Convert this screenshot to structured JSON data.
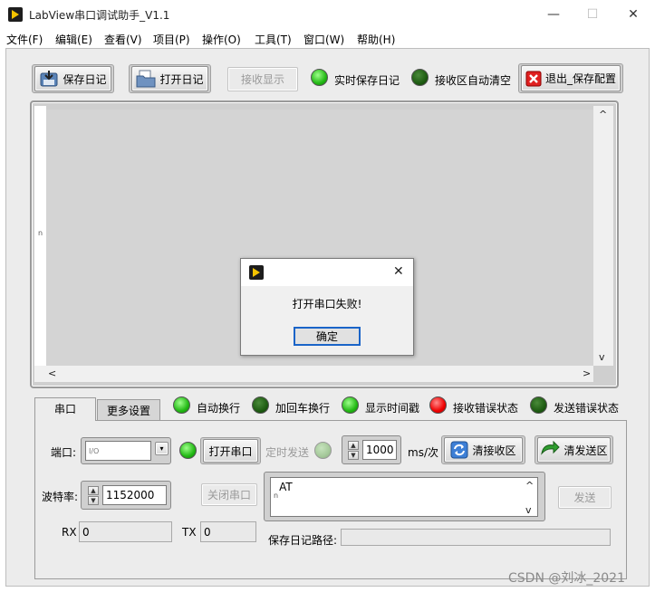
{
  "window": {
    "title": "LabView串口调试助手_V1.1",
    "minimize": "—",
    "maximize": "☐",
    "close": "✕"
  },
  "menu": [
    "文件(F)",
    "编辑(E)",
    "查看(V)",
    "项目(P)",
    "操作(O)",
    "工具(T)",
    "窗口(W)",
    "帮助(H)"
  ],
  "toolbar": {
    "save_log": "保存日记",
    "open_log": "打开日记",
    "recv_display": "接收显示",
    "realtime_save_label": "实时保存日记",
    "auto_clear_label": "接收区自动清空",
    "exit_save": "退出_保存配置"
  },
  "receive": {
    "row_marker": "n",
    "scroll_up": "^",
    "scroll_down": "v",
    "scroll_left": "<",
    "scroll_right": ">"
  },
  "tabs": [
    "串口",
    "更多设置"
  ],
  "indicators": {
    "auto_newline": "自动换行",
    "add_cr": "加回车换行",
    "show_timestamp": "显示时间戳",
    "recv_error": "接收错误状态",
    "send_error": "发送错误状态"
  },
  "serial": {
    "port_label": "端口:",
    "port_icon": "I/O",
    "port_value": "",
    "open_port": "打开串口",
    "timed_send": "定时发送",
    "interval_value": "1000",
    "interval_unit": "ms/次",
    "clear_recv": "清接收区",
    "clear_send": "清发送区",
    "baud_label": "波特率:",
    "baud_value": "1152000",
    "close_port": "关闭串口",
    "send_text": "AT",
    "send_button": "发送",
    "rx_label": "RX",
    "rx_value": "0",
    "tx_label": "TX",
    "tx_value": "0",
    "log_path_label": "保存日记路径:",
    "log_path_value": ""
  },
  "dialog": {
    "message": "打开串口失败!",
    "ok": "确定",
    "close": "✕"
  },
  "watermark": "CSDN @刘冰_2021",
  "colors": {
    "led_on": "#22b814",
    "led_off": "#1e5c12",
    "led_error": "#ef0000",
    "dialog_focus": "#1a64c8"
  }
}
